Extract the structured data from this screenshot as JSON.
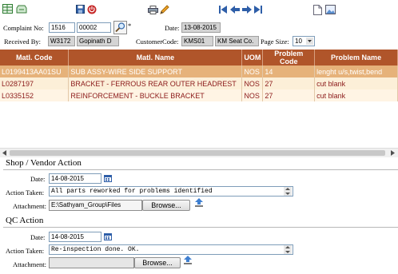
{
  "toolbar": {
    "icons": [
      "grid-add-icon",
      "tray-icon",
      "save-icon",
      "power-icon",
      "printer-icon",
      "pencil-icon",
      "first-icon",
      "prev-icon",
      "next-icon",
      "last-icon",
      "new-page-icon",
      "image-icon"
    ]
  },
  "form": {
    "complaint_no_label": "Complaint No:",
    "complaint_no_prefix": "1516",
    "complaint_no_value": "00002",
    "date_label": "Date:",
    "date_value": "13-08-2015",
    "received_by_label": "Received By:",
    "received_by_code": "W3172",
    "received_by_name": "Gopinath D",
    "customer_code_label": "CustomerCode:",
    "customer_code": "KMS01",
    "customer_name": "KM Seat Co.",
    "page_size_label": "Page Size:",
    "page_size_value": "10",
    "asterisk": "*"
  },
  "grid": {
    "columns": [
      "Matl. Code",
      "Matl. Name",
      "UOM",
      "Problem Code",
      "Problem Name"
    ],
    "rows": [
      {
        "code": "L0199413AA01SU",
        "name": "SUB ASSY-WIRE SIDE SUPPORT",
        "uom": "NOS",
        "pcode": "14",
        "pname": "lenght u/s,twist,bend"
      },
      {
        "code": "L0287197",
        "name": "BRACKET - FERROUS REAR OUTER HEADREST",
        "uom": "NOS",
        "pcode": "27",
        "pname": "cut blank"
      },
      {
        "code": "L0335152",
        "name": "REINFORCEMENT - BUCKLE BRACKET",
        "uom": "NOS",
        "pcode": "27",
        "pname": "cut blank"
      }
    ]
  },
  "shop": {
    "title": "Shop / Vendor Action",
    "date_label": "Date:",
    "date_value": "14-08-2015",
    "action_label": "Action Taken:",
    "action_value": "All parts reworked for problems identified",
    "attach_label": "Attachment:",
    "attach_value": "E:\\Sathyam_Group\\Files",
    "browse_label": "Browse..."
  },
  "qc": {
    "title": "QC Action",
    "date_label": "Date:",
    "date_value": "14-08-2015",
    "action_label": "Action Taken:",
    "action_value": "Re-inspection done. OK.",
    "attach_label": "Attachment:",
    "attach_value": "",
    "browse_label": "Browse..."
  }
}
